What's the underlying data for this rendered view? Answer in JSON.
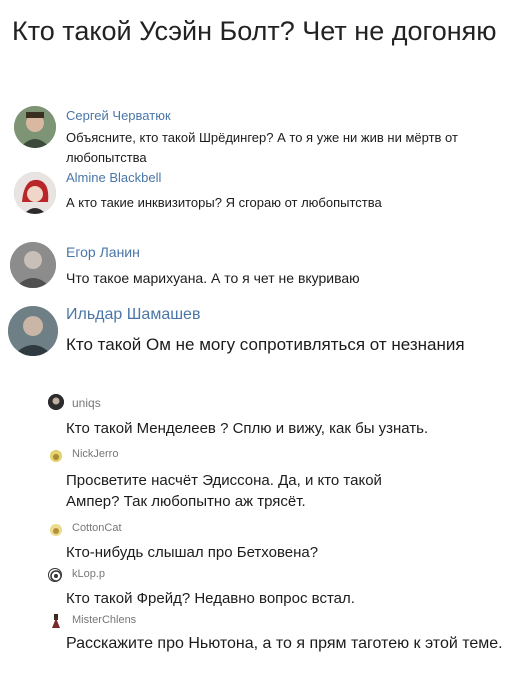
{
  "post": {
    "title": "Кто такой Усэйн Болт? Чет не догоняю"
  },
  "comments": [
    {
      "author": "Сергей Черватюк",
      "text": "Объясните, кто такой Шрёдингер? А то я уже ни жив ни мёртв от любопытства"
    },
    {
      "author": "Almine Blackbell",
      "text": "А кто такие инквизиторы? Я сгораю от любопытства"
    },
    {
      "author": "Егор Ланин",
      "text": "Что такое марихуана. А то я чет не вкуриваю"
    },
    {
      "author": "Ильдар Шамашев",
      "text": "Кто такой Ом не могу сопротивляться от незнания"
    },
    {
      "author": "uniqs",
      "text": "Кто такой Менделеев ? Сплю и вижу, как бы узнать."
    },
    {
      "author": "NickJerro",
      "text": "Просветите насчёт Эдиссона. Да, и кто такой Ампер? Так любопытно аж трясёт."
    },
    {
      "author": "CottonCat",
      "text": "Кто-нибудь слышал про Бетховена?"
    },
    {
      "author": "kLop.p",
      "text": "Кто такой Фрейд? Недавно вопрос встал."
    },
    {
      "author": "MisterChlens",
      "text": "Расскажите про Ньютона, а то я прям таготею к этой теме."
    }
  ]
}
